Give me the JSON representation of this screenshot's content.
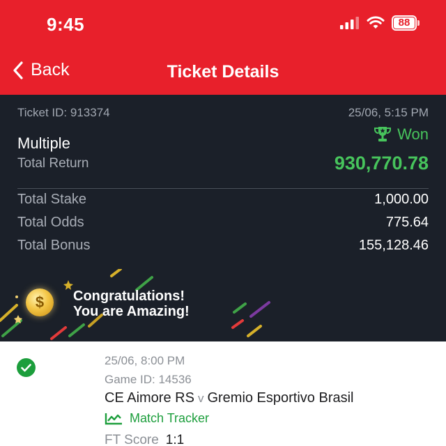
{
  "status_bar": {
    "time": "9:45",
    "battery": "88"
  },
  "nav": {
    "back_label": "Back",
    "title": "Ticket Details"
  },
  "ticket": {
    "id_text": "Ticket ID: 913374",
    "datetime": "25/06, 5:15 PM",
    "status": "Won",
    "bet_type": "Multiple",
    "total_return_label": "Total Return",
    "total_return_value": "930,770.78",
    "details": [
      {
        "label": "Total Stake",
        "value": "1,000.00"
      },
      {
        "label": "Total Odds",
        "value": "775.64"
      },
      {
        "label": "Total Bonus",
        "value": "155,128.46"
      }
    ]
  },
  "banner": {
    "line1": "Congratulations!",
    "line2": "You are Amazing!"
  },
  "selection": {
    "datetime": "25/06, 8:00 PM",
    "game_id": "Game ID: 14536",
    "home": "CE Aimore RS",
    "vs": "v",
    "away": "Gremio Esportivo Brasil",
    "tracker_label": "Match Tracker",
    "score_label": "FT Score",
    "score_value": "1:1"
  },
  "colors": {
    "brand_red": "#e8202b",
    "dark_panel": "#1b2029",
    "won_green": "#47c45c",
    "success_green": "#1c9e3c"
  },
  "icons": [
    "signal-icon",
    "wifi-icon",
    "battery-icon",
    "back-chevron-icon",
    "trophy-icon",
    "coin-icon",
    "check-circle-icon",
    "chart-line-icon"
  ]
}
